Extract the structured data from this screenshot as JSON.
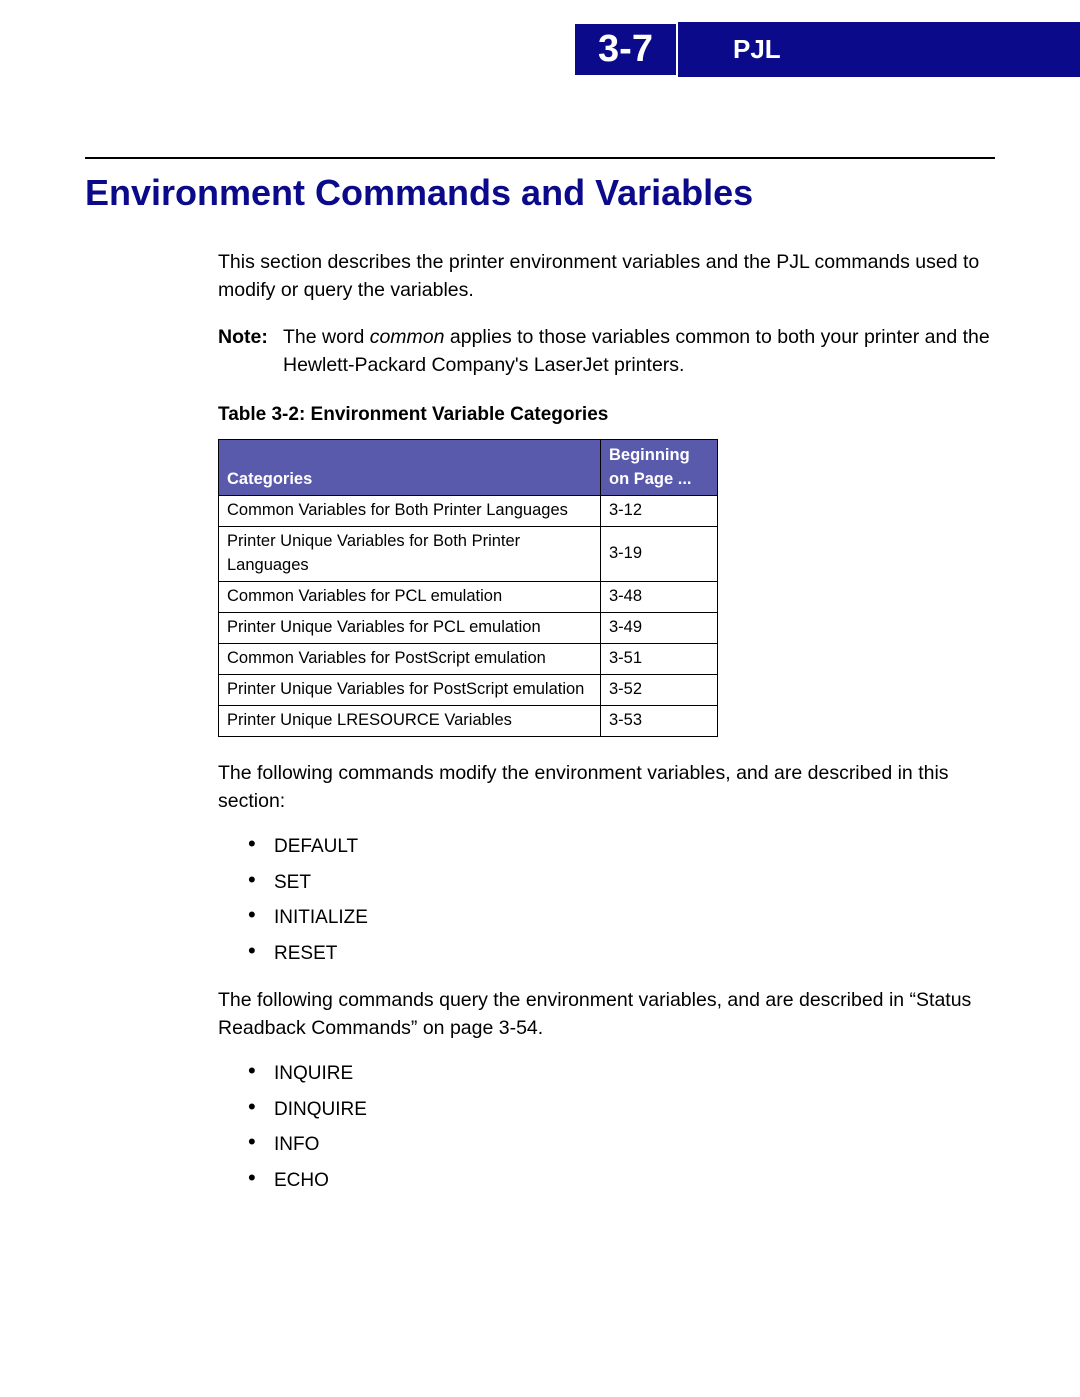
{
  "header": {
    "page_number": "3-7",
    "title": "PJL"
  },
  "heading": "Environment Commands and Variables",
  "intro": "This section describes the printer environment variables and the PJL commands used to modify or query the variables.",
  "note": {
    "label": "Note:",
    "body_prefix": "The word ",
    "italic_word": "common",
    "body_suffix": " applies to those variables common to both your printer and the Hewlett-Packard Company's LaserJet printers."
  },
  "table": {
    "caption": "Table 3-2:  Environment Variable Categories",
    "col1": "Categories",
    "col2_line1": "Beginning",
    "col2_line2": "on Page ...",
    "rows": [
      {
        "cat": "Common Variables for Both Printer Languages",
        "page": "3-12"
      },
      {
        "cat": "Printer Unique Variables for Both Printer Languages",
        "page": "3-19"
      },
      {
        "cat": "Common Variables for PCL emulation",
        "page": "3-48"
      },
      {
        "cat": "Printer Unique Variables for PCL emulation",
        "page": "3-49"
      },
      {
        "cat": "Common Variables for PostScript emulation",
        "page": "3-51"
      },
      {
        "cat": "Printer Unique Variables for PostScript emulation",
        "page": "3-52"
      },
      {
        "cat": "Printer Unique LRESOURCE Variables",
        "page": "3-53"
      }
    ]
  },
  "para_modify": "The following commands modify the environment variables, and are described in this section:",
  "modify_list": [
    "DEFAULT",
    "SET",
    "INITIALIZE",
    "RESET"
  ],
  "para_query": "The following commands query the environment variables, and are described in “Status Readback Commands” on page 3-54.",
  "query_list": [
    "INQUIRE",
    "DINQUIRE",
    "INFO",
    "ECHO"
  ]
}
